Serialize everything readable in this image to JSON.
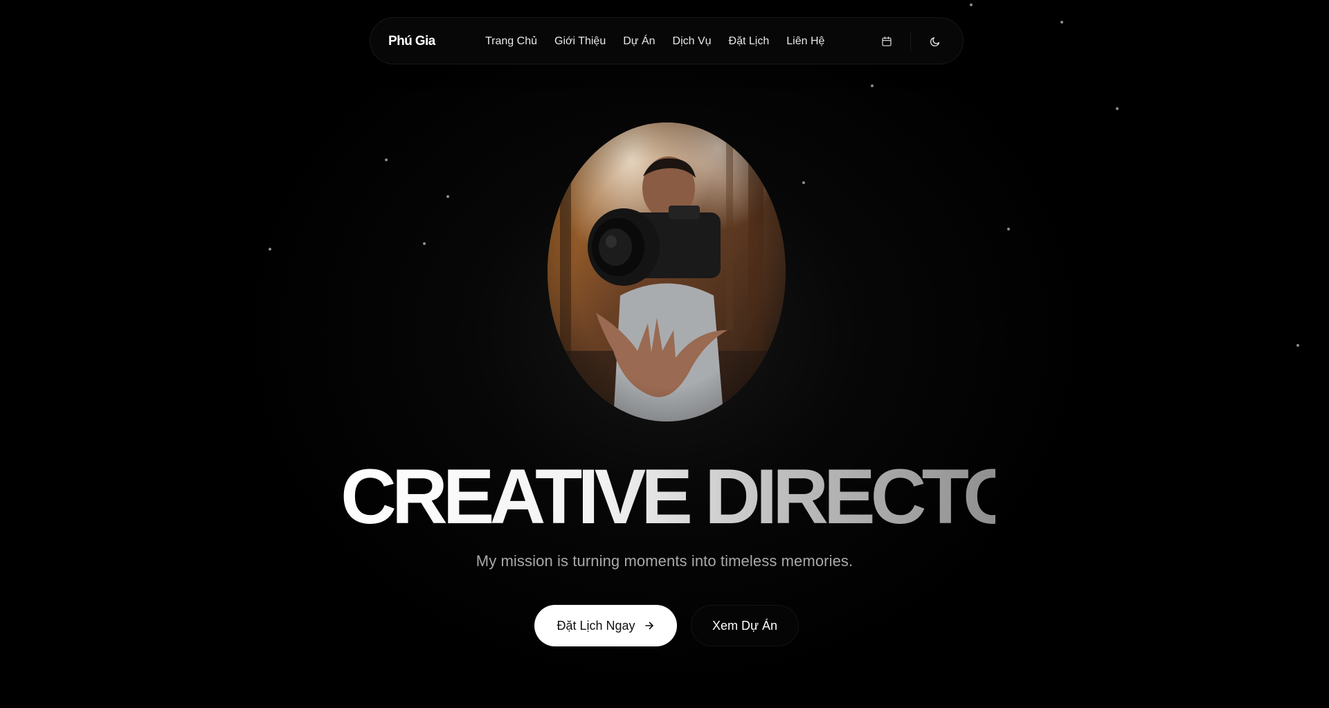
{
  "nav": {
    "brand": "Phú Gia",
    "items": [
      {
        "label": "Trang Chủ"
      },
      {
        "label": "Giới Thiệu"
      },
      {
        "label": "Dự Án"
      },
      {
        "label": "Dịch Vụ"
      },
      {
        "label": "Đặt Lịch"
      },
      {
        "label": "Liên Hệ"
      }
    ],
    "icons": {
      "calendar": "calendar-icon",
      "theme": "moon-icon"
    }
  },
  "hero": {
    "headline": "CREATIVE DIRECTOR",
    "subtitle": "My mission is turning moments into timeless memories.",
    "primary_button": "Đặt Lịch Ngay",
    "primary_icon": "arrow-right-icon",
    "secondary_button": "Xem Dự Án"
  },
  "colors": {
    "background": "#000000",
    "primary_button_bg": "#ffffff",
    "subtitle": "#a9a9a9"
  }
}
